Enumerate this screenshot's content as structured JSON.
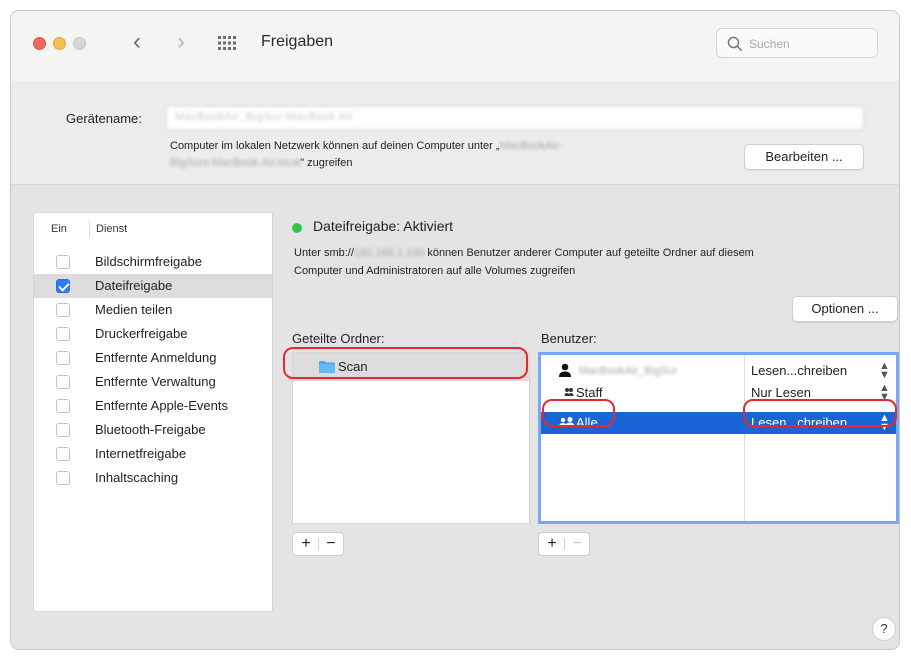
{
  "window": {
    "title": "Freigaben"
  },
  "search": {
    "placeholder": "Suchen"
  },
  "device": {
    "label": "Gerätename:",
    "name_value": "MacBookAir_BigSur-MacBook Air",
    "info_prefix": "Computer im lokalen Netzwerk können auf deinen Computer unter „",
    "info_host_blurred": "MacBookAir-",
    "info_host_blurred_2": "BigSurs-MacBook-Air.local",
    "info_suffix": "\" zugreifen",
    "edit_button": "Bearbeiten ..."
  },
  "services": {
    "col_on": "Ein",
    "col_service": "Dienst",
    "items": [
      {
        "label": "Bildschirmfreigabe",
        "checked": false
      },
      {
        "label": "Dateifreigabe",
        "checked": true
      },
      {
        "label": "Medien teilen",
        "checked": false
      },
      {
        "label": "Druckerfreigabe",
        "checked": false
      },
      {
        "label": "Entfernte Anmeldung",
        "checked": false
      },
      {
        "label": "Entfernte Verwaltung",
        "checked": false
      },
      {
        "label": "Entfernte Apple-Events",
        "checked": false
      },
      {
        "label": "Bluetooth-Freigabe",
        "checked": false
      },
      {
        "label": "Internetfreigabe",
        "checked": false
      },
      {
        "label": "Inhaltscaching",
        "checked": false
      }
    ]
  },
  "status": {
    "title": "Dateifreigabe: Aktiviert",
    "desc_prefix": "Unter smb://",
    "desc_blurred": "192.168.1.100",
    "desc_suffix": " können Benutzer anderer Computer auf geteilte Ordner auf diesem",
    "desc_line2": "Computer und Administratoren auf alle Volumes zugreifen",
    "status_color": "#33c748"
  },
  "options_button": "Optionen ...",
  "shared_folders": {
    "label": "Geteilte Ordner:",
    "items": [
      "Scan"
    ]
  },
  "users": {
    "label": "Benutzer:",
    "rows": [
      {
        "name": "MacBookAir_BigSur",
        "permission": "Lesen...chreiben",
        "icon": "person-icon"
      },
      {
        "name": "Staff",
        "permission": "Nur Lesen",
        "icon": "group-icon"
      },
      {
        "name": "Alle",
        "permission": "Lesen...chreiben",
        "icon": "everyone-icon"
      }
    ]
  },
  "controls": {
    "plus": "+",
    "minus": "−",
    "help": "?"
  },
  "colors": {
    "selection": "#1866d6",
    "accent": "#2f7cf6",
    "annotation": "#e8282e"
  }
}
